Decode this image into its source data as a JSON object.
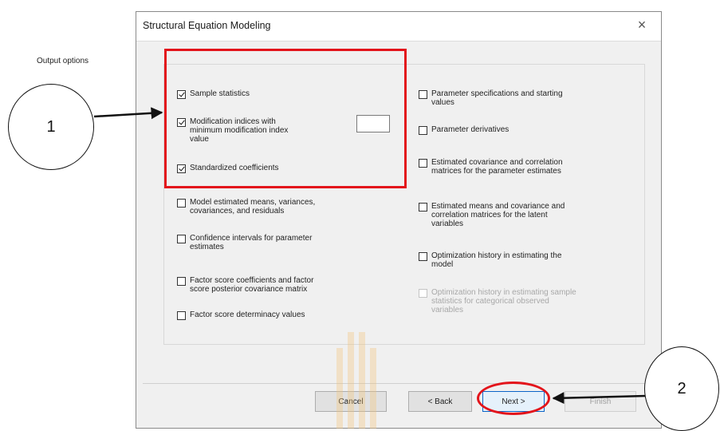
{
  "dialog": {
    "title": "Structural Equation Modeling",
    "close_symbol": "×",
    "group_title": "Output options",
    "left_options": [
      {
        "label": "Sample statistics",
        "checked": true
      },
      {
        "label": "Modification indices with\nminimum modification index\nvalue",
        "checked": true
      },
      {
        "label": "Standardized coefficients",
        "checked": true
      },
      {
        "label": "Model estimated means, variances,\ncovariances, and residuals",
        "checked": false
      },
      {
        "label": "Confidence intervals for parameter\nestimates",
        "checked": false
      },
      {
        "label": "Factor score coefficients and factor\nscore posterior covariance matrix",
        "checked": false
      },
      {
        "label": "Factor score determinacy values",
        "checked": false
      }
    ],
    "right_options": [
      {
        "label": "Parameter specifications and starting\nvalues",
        "checked": false,
        "enabled": true
      },
      {
        "label": "Parameter derivatives",
        "checked": false,
        "enabled": true
      },
      {
        "label": "Estimated covariance and correlation\nmatrices for the parameter estimates",
        "checked": false,
        "enabled": true
      },
      {
        "label": "Estimated means and covariance and\ncorrelation matrices for the latent\nvariables",
        "checked": false,
        "enabled": true
      },
      {
        "label": "Optimization history in estimating the\nmodel",
        "checked": false,
        "enabled": true
      },
      {
        "label": "Optimization history in estimating sample\nstatistics for categorical observed\nvariables",
        "checked": false,
        "enabled": false
      }
    ],
    "min_index_value": "",
    "buttons": {
      "cancel": "Cancel",
      "back": "< Back",
      "next": "Next >",
      "finish": "Finish"
    }
  },
  "callouts": {
    "one": "1",
    "two": "2"
  },
  "colors": {
    "highlight": "#e3141b",
    "dialog_bg": "#f0f0f0",
    "primary_border": "#0a64c8"
  }
}
